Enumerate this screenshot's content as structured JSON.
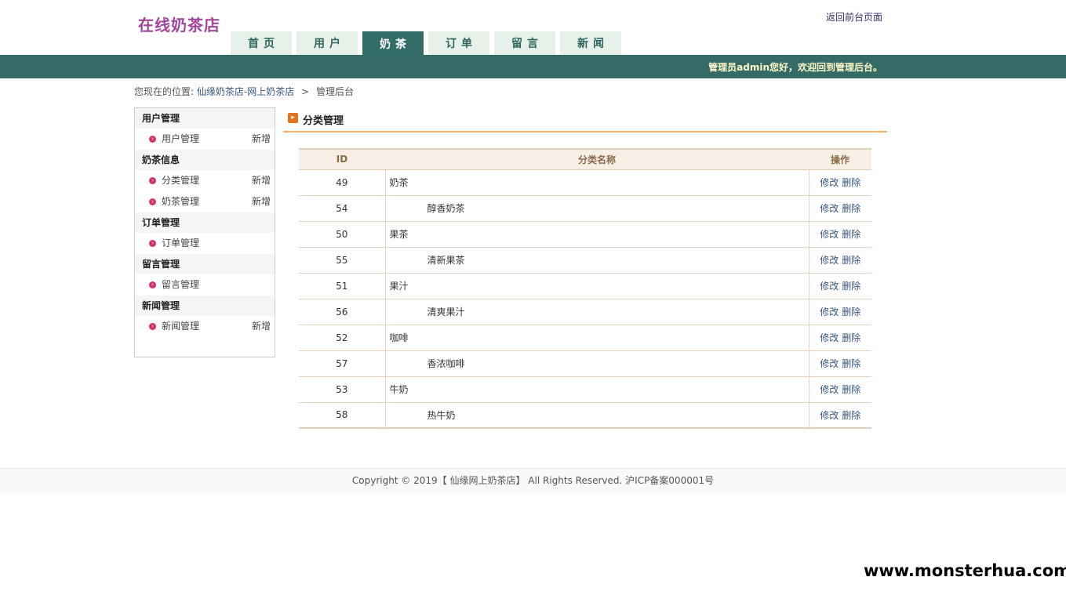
{
  "header": {
    "logo": "在线奶茶店",
    "back_link": "返回前台页面"
  },
  "nav": {
    "tabs": [
      {
        "label": "首页"
      },
      {
        "label": "用户"
      },
      {
        "label": "奶茶"
      },
      {
        "label": "订单"
      },
      {
        "label": "留言"
      },
      {
        "label": "新闻"
      }
    ],
    "active_index": 2
  },
  "topbar": {
    "welcome": "管理员admin您好，欢迎回到管理后台。"
  },
  "breadcrumb": {
    "prefix": "您现在的位置:",
    "site": "仙缘奶茶店-网上奶茶店",
    "sep": ">",
    "current": "管理后台"
  },
  "sidebar": {
    "groups": [
      {
        "title": "用户管理",
        "items": [
          {
            "label": "用户管理",
            "add": "新增"
          }
        ]
      },
      {
        "title": "奶茶信息",
        "items": [
          {
            "label": "分类管理",
            "add": "新增"
          },
          {
            "label": "奶茶管理",
            "add": "新增"
          }
        ]
      },
      {
        "title": "订单管理",
        "items": [
          {
            "label": "订单管理",
            "add": ""
          }
        ]
      },
      {
        "title": "留言管理",
        "items": [
          {
            "label": "留言管理",
            "add": ""
          }
        ]
      },
      {
        "title": "新闻管理",
        "items": [
          {
            "label": "新闻管理",
            "add": "新增"
          }
        ]
      }
    ]
  },
  "panel": {
    "title": "分类管理"
  },
  "table": {
    "headers": {
      "id": "ID",
      "name": "分类名称",
      "ops": "操作"
    },
    "edit_label": "修改",
    "delete_label": "删除",
    "rows": [
      {
        "id": "49",
        "name": "奶茶",
        "child": false
      },
      {
        "id": "54",
        "name": "醇香奶茶",
        "child": true
      },
      {
        "id": "50",
        "name": "果茶",
        "child": false
      },
      {
        "id": "55",
        "name": "清新果茶",
        "child": true
      },
      {
        "id": "51",
        "name": "果汁",
        "child": false
      },
      {
        "id": "56",
        "name": "清爽果汁",
        "child": true
      },
      {
        "id": "52",
        "name": "咖啡",
        "child": false
      },
      {
        "id": "57",
        "name": "香浓咖啡",
        "child": true
      },
      {
        "id": "53",
        "name": "牛奶",
        "child": false
      },
      {
        "id": "58",
        "name": "热牛奶",
        "child": true
      }
    ]
  },
  "footer": {
    "text": "Copyright © 2019【 仙缘网上奶茶店】 All Rights Reserved. 沪ICP备案000001号"
  },
  "watermark": "www.monsterhua.com",
  "colors": {
    "brand": "#356b67",
    "logo": "#a0479c",
    "accent": "#f0b070",
    "bullet": "#d2326a"
  }
}
